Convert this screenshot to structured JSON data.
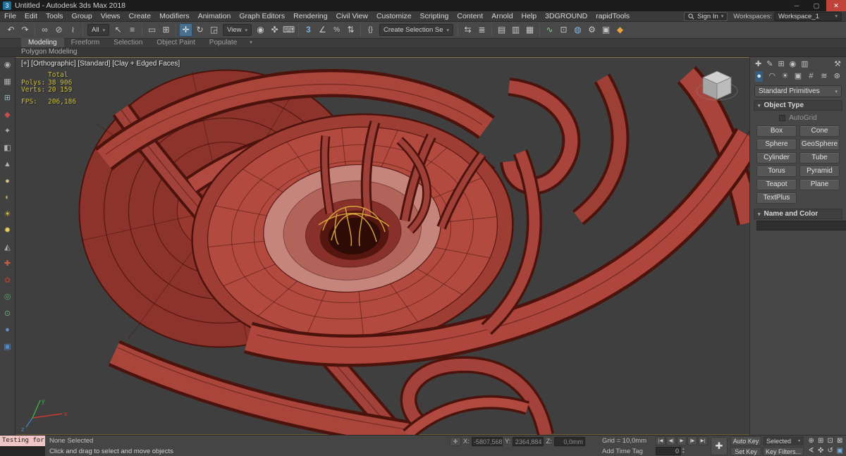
{
  "colors": {
    "accent_blue": "#49708f",
    "viewport_bg": "#3f3f3f",
    "clay_red": "#b04a40",
    "spline_yellow": "#d9a93b",
    "stats_yellow": "#cdbd3a",
    "close_red": "#c0433b",
    "listener_pink": "#efc5c5"
  },
  "titlebar": {
    "logo": "3",
    "title": "Untitled - Autodesk 3ds Max 2018",
    "minimize": "─",
    "maximize": "▢",
    "close": "✕"
  },
  "menubar": {
    "items": [
      "File",
      "Edit",
      "Tools",
      "Group",
      "Views",
      "Create",
      "Modifiers",
      "Animation",
      "Graph Editors",
      "Rendering",
      "Civil View",
      "Customize",
      "Scripting",
      "Content",
      "Arnold",
      "Help",
      "3DGROUND",
      "rapidTools"
    ],
    "sign_in": "Sign In",
    "workspaces_label": "Workspaces:",
    "workspace": "Workspace_1"
  },
  "ui": {
    "dropdown_arrow": "▾",
    "spin_up": "▴",
    "spin_down": "▾",
    "rollout_open": "▾"
  },
  "toolbar": {
    "selection_filter": "All",
    "coordsys": "View",
    "named_sets": "Create Selection Se",
    "icons": {
      "undo": "↶",
      "redo": "↷",
      "select_and_link": "∞",
      "unlink_selection": "⊘",
      "bind_to_space_warp": "≀",
      "select_object": "↖",
      "select_by_name": "≡",
      "selection_region": "▭",
      "window_crossing": "⊞",
      "select_and_move": "✛",
      "select_and_rotate": "↻",
      "select_and_scale": "◲",
      "use_center": "◉",
      "select_and_manipulate": "✜",
      "keyboard_override": "⌨",
      "snaps_toggle": "3",
      "angle_snap": "∠",
      "percent_snap": "%",
      "spinner_snap": "⇅",
      "named_selection_sets": "{}",
      "mirror": "⇆",
      "align": "≣",
      "scene_explorer": "▤",
      "layer_explorer": "▥",
      "ribbon_toggle": "▦",
      "curve_editor": "∿",
      "schematic_view": "⊡",
      "material_editor": "◍",
      "render_setup": "⚙",
      "rendered_frame": "▣",
      "render": "◆"
    }
  },
  "ribbon": {
    "tabs": [
      "Modeling",
      "Freeform",
      "Selection",
      "Object Paint",
      "Populate"
    ],
    "active_tab": "Modeling",
    "options_icon": "▾",
    "panel_label": "Polygon Modeling"
  },
  "left_toolbar": {
    "icons": [
      "◉",
      "▦",
      "⊞",
      "◆",
      "✦",
      "◧",
      "▲",
      "●",
      "◐",
      "☀",
      "✹",
      "◭",
      "✚",
      "✿",
      "◎",
      "⊙",
      "●",
      "▣"
    ]
  },
  "viewport": {
    "label": "[+] [Orthographic] [Standard] [Clay + Edged Faces]",
    "stats": {
      "total_label": "Total",
      "polys_label": "Polys:",
      "polys_value": "38 906",
      "verts_label": "Verts:",
      "verts_value": "20 159",
      "fps_label": "FPS:",
      "fps_value": "206,186"
    },
    "axis": {
      "x": "x",
      "y": "y",
      "z": "z"
    }
  },
  "command_panel": {
    "tabs": {
      "create": "✚",
      "modify": "✎",
      "hierarchy": "⊞",
      "motion": "◉",
      "display": "▥",
      "utilities": "⚒"
    },
    "categories": {
      "geometry": "●",
      "shapes": "◠",
      "lights": "☀",
      "cameras": "▣",
      "helpers": "#",
      "space_warps": "≋",
      "systems": "⊛"
    },
    "subcategory_dropdown": "Standard Primitives",
    "object_type": {
      "title": "Object Type",
      "autogrid_label": "AutoGrid",
      "buttons": [
        "Box",
        "Cone",
        "Sphere",
        "GeoSphere",
        "Cylinder",
        "Tube",
        "Torus",
        "Pyramid",
        "Teapot",
        "Plane",
        "TextPlus"
      ]
    },
    "name_and_color": {
      "title": "Name and Color",
      "name_value": ""
    }
  },
  "statusbar": {
    "listener_text": "Testing for i",
    "selection_status": "None Selected",
    "prompt": "Click and drag to select and move objects",
    "lock_icon": "✛",
    "coords": {
      "x_label": "X:",
      "x_value": "-5807,568",
      "y_label": "Y:",
      "y_value": "2364,884",
      "z_label": "Z:",
      "z_value": "0,0mm"
    },
    "grid_text": "Grid = 10,0mm",
    "add_time_tag": "Add Time Tag",
    "transport": {
      "go_start": "|◀",
      "prev_key": "◀|",
      "play": "▶",
      "next_key": "|▶",
      "go_end": "▶|"
    },
    "frame_value": "0",
    "set_keys_icon": "✚",
    "auto_key": "Auto Key",
    "selected_filter": "Selected",
    "set_key": "Set Key",
    "key_filters": "Key Filters...",
    "nav": {
      "zoom": "⊕",
      "zoom_all": "⊞",
      "zoom_extents": "⊡",
      "zoom_extents_all": "⊠",
      "fov": "∢",
      "pan": "✜",
      "orbit": "↺",
      "maximize": "▣"
    }
  }
}
